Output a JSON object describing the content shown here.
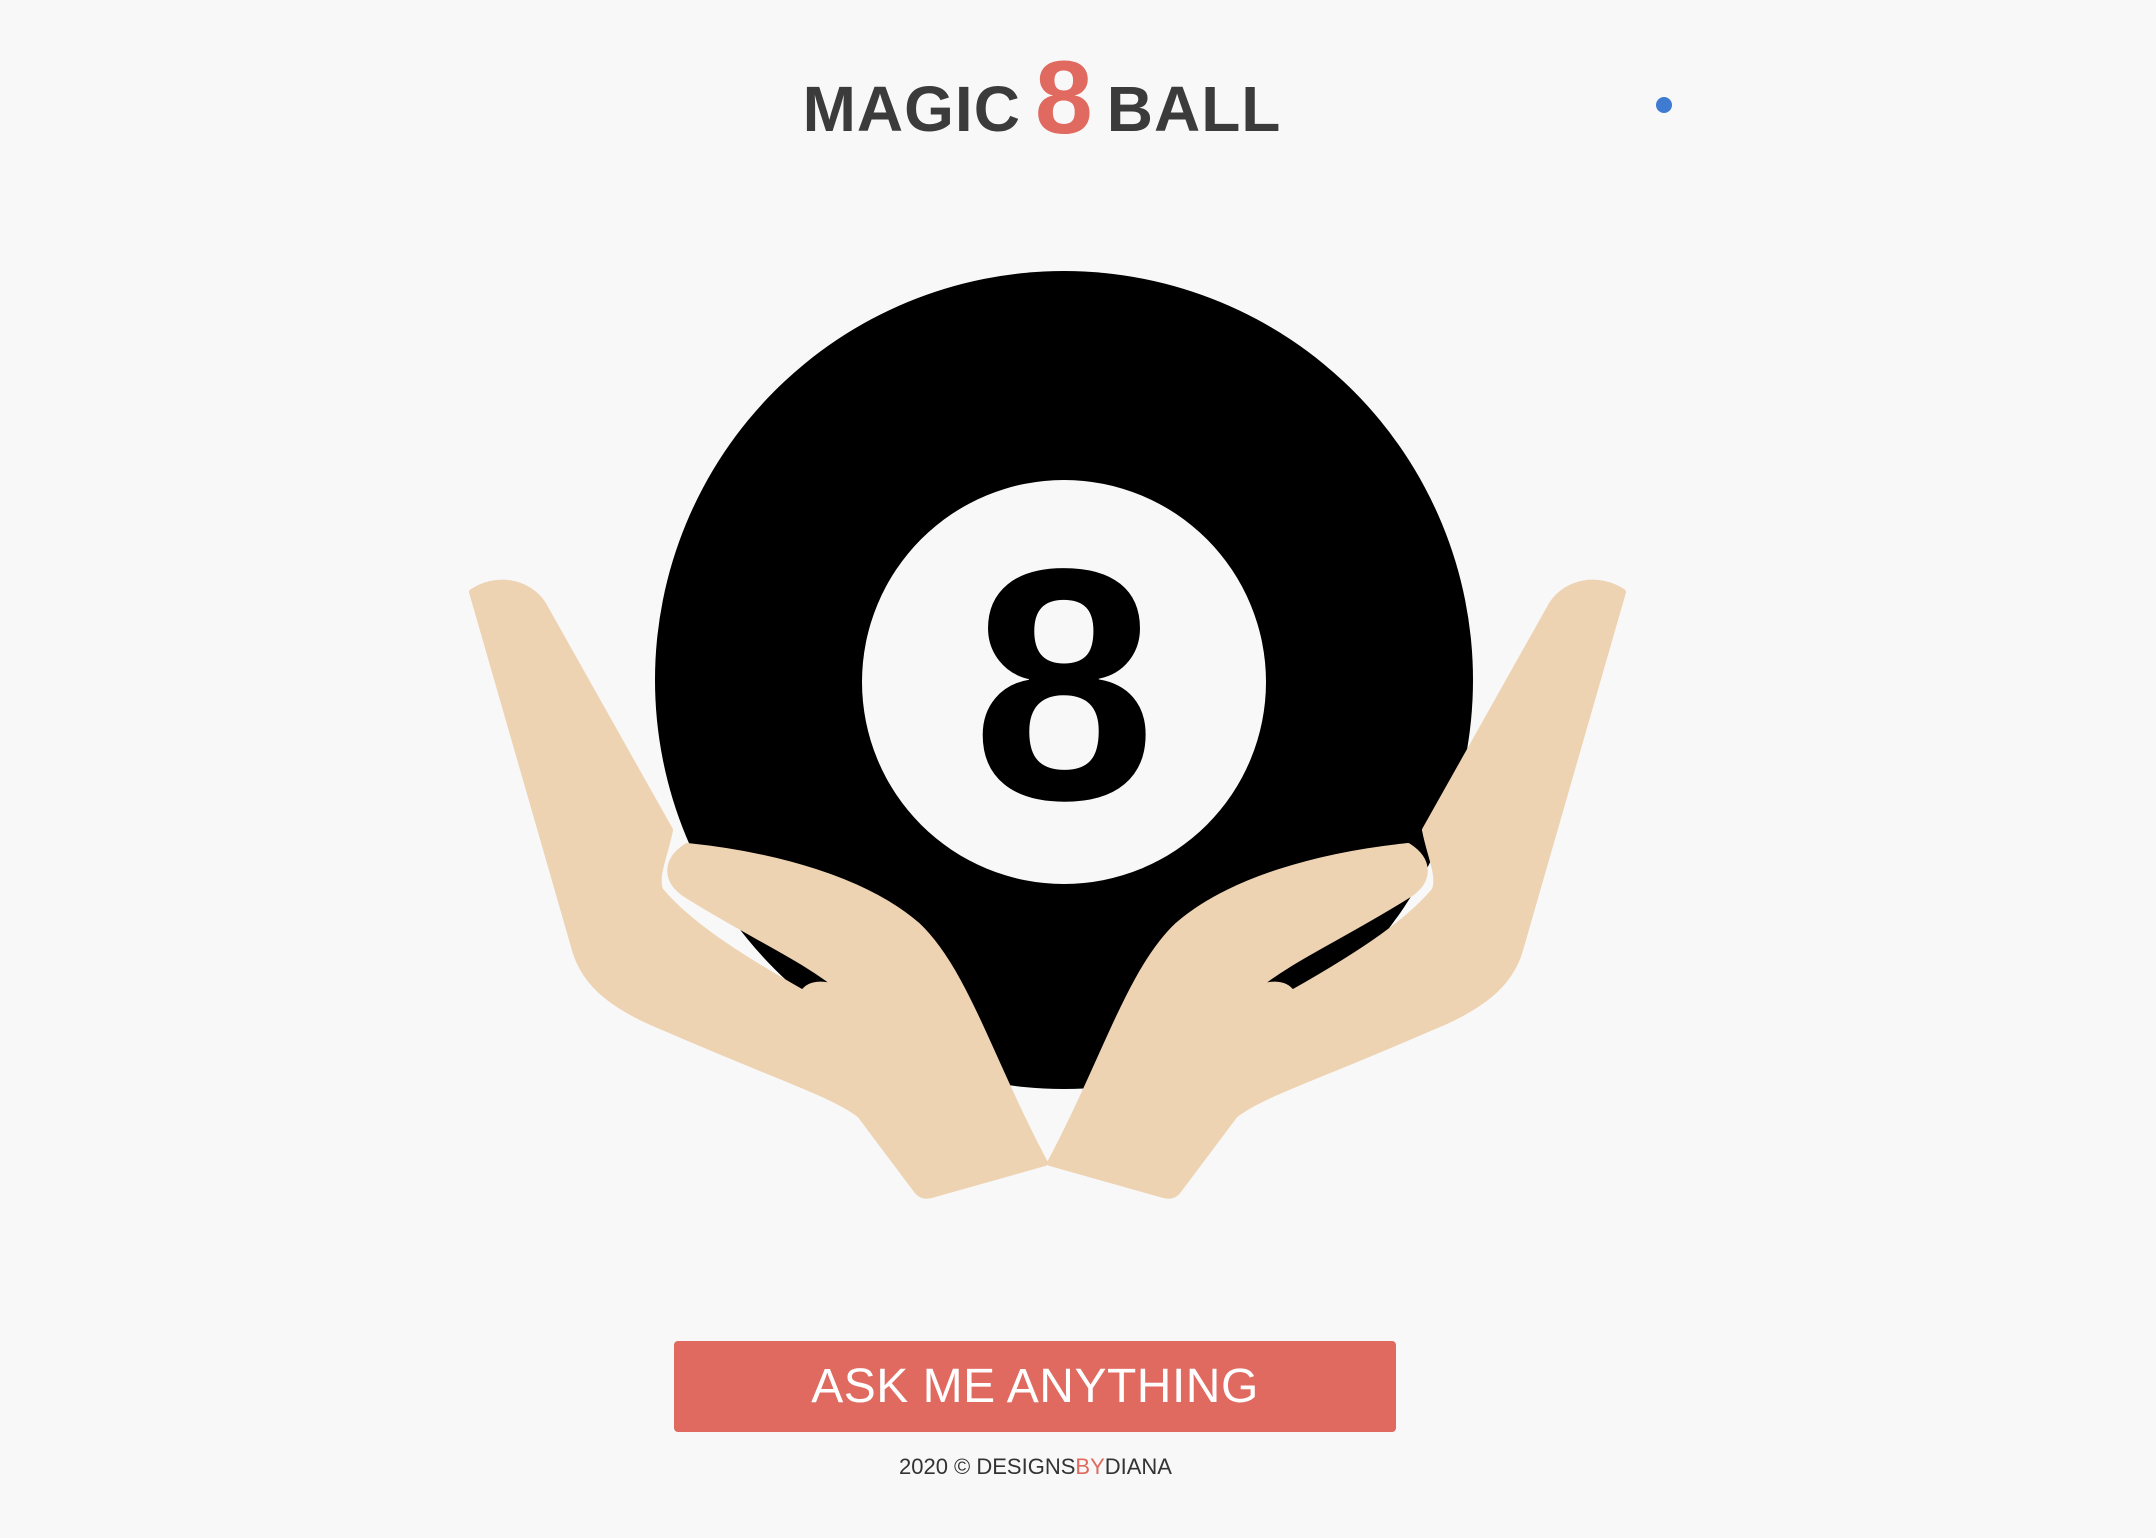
{
  "header": {
    "title_left": "MAGIC",
    "title_number": "8",
    "title_right": "BALL"
  },
  "ball": {
    "number": "8"
  },
  "actions": {
    "ask_label": "ASK ME ANYTHING"
  },
  "footer": {
    "prefix": "2020 © DESIGNS",
    "highlight": "BY",
    "suffix": "DIANA"
  },
  "colors": {
    "accent": "#e06a5f",
    "text": "#3b3b3b",
    "background": "#f8f8f8",
    "ball": "#000000",
    "hands": "#eed3b2",
    "dot": "#3f7bd1"
  }
}
